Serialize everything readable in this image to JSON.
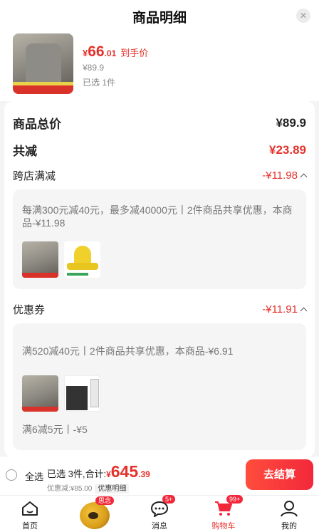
{
  "header": {
    "title": "商品明细",
    "close": "✕"
  },
  "product": {
    "currency": "¥",
    "price_int": "66",
    "price_dec": ".01",
    "price_tag": "到手价",
    "original_price": "¥89.9",
    "selected": "已选 1件"
  },
  "summary": {
    "total_label": "商品总价",
    "total_value": "¥89.9",
    "reduce_label": "共减",
    "reduce_value": "¥23.89"
  },
  "cross_store": {
    "label": "跨店满减",
    "amount": "-¥11.98",
    "desc": "每满300元减40元，最多减40000元丨2件商品共享优惠，本商品-¥11.98"
  },
  "coupon": {
    "label": "优惠券",
    "amount": "-¥11.91",
    "desc": "满520减40元丨2件商品共享优惠，本商品-¥6.91",
    "desc2": "满6减5元丨-¥5"
  },
  "bottom": {
    "select_all": "全选",
    "selected_count": "已选 3件,合计:",
    "currency": "¥",
    "total_int": "645",
    "total_dec": ".39",
    "discount": "优惠减:¥85.00",
    "detail": "优惠明细",
    "checkout": "去结算"
  },
  "tabs": [
    {
      "label": "首页",
      "icon": "home-icon"
    },
    {
      "label": "",
      "icon": "promo-icon",
      "badge": "思念"
    },
    {
      "label": "消息",
      "icon": "message-icon",
      "badge": "5+"
    },
    {
      "label": "购物车",
      "icon": "cart-icon",
      "badge": "99+"
    },
    {
      "label": "我的",
      "icon": "profile-icon"
    }
  ],
  "colors": {
    "accent": "#e4312b",
    "checkout_start": "#ff4d3d",
    "checkout_end": "#f2283a"
  }
}
